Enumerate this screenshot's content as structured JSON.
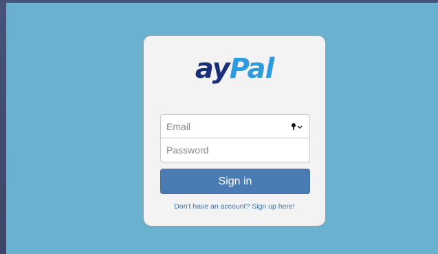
{
  "logo": {
    "part1": "ay",
    "part2": "Pal"
  },
  "form": {
    "email_placeholder": "Email",
    "password_placeholder": "Password",
    "email_icon": "key-icon",
    "signin_label": "Sign in",
    "signup_text": "Don't have an account? Sign up here!"
  },
  "colors": {
    "background": "#69b1cf",
    "card": "#f3f3f3",
    "logo_dark": "#1a2f7a",
    "logo_light": "#2e9be0",
    "button": "#4a7cb3",
    "link": "#3a6fa8"
  }
}
